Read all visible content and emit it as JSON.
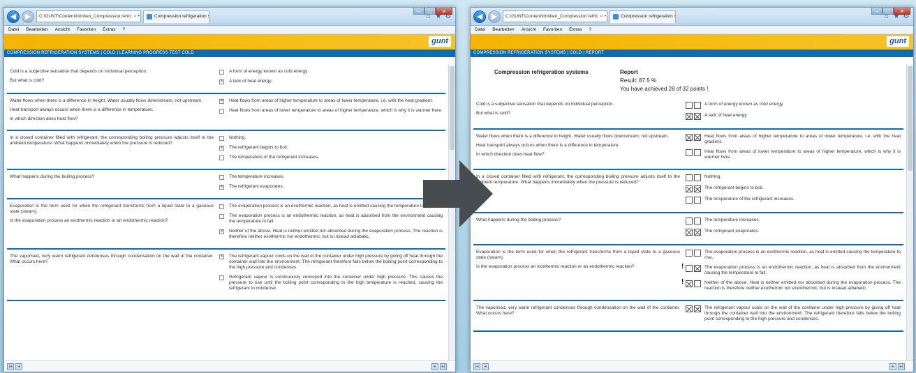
{
  "browser": {
    "address": "C:\\GUNT\\Content\\html\\en_Compression refric",
    "address_icons": "⌕ • C ✕",
    "tab_title": "Compression refrigeration s...",
    "tab_close": "×",
    "menu": [
      "Datei",
      "Bearbeiten",
      "Ansicht",
      "Favoriten",
      "Extras",
      "?"
    ],
    "brand_logo": "gunt",
    "home_icon": "⌂",
    "star_icon": "★",
    "gear_icon": "⚙",
    "window_controls": [
      "–",
      "□",
      "✕"
    ]
  },
  "left": {
    "breadcrumb": "Compression refrigeration systems | Cold | Learning progress test Cold",
    "questions": [
      {
        "text": [
          "Cold is a subjective sensation that depends on individual perception.",
          "But what is cold?"
        ],
        "answers": [
          {
            "text": "A form of energy known as cold energy",
            "checked": false
          },
          {
            "text": "A lack of heat energy",
            "checked": true
          }
        ]
      },
      {
        "text": [
          "Water flows when there is a difference in height. Water usually flows downstream, not upstream.",
          "Heat transport always occurs when there is a difference in temperature.",
          "In which direction does heat flow?"
        ],
        "answers": [
          {
            "text": "Heat flows from areas of higher temperature to areas of lower temperature, i.e. with the heat gradient.",
            "checked": true
          },
          {
            "text": "Heat flows from areas of lower temperature to areas of higher temperature, which is why it is warmer here.",
            "checked": false
          }
        ]
      },
      {
        "text": [
          "In a closed container filled with refrigerant, the corresponding boiling pressure adjusts itself to the ambient temperature. What happens immediately when the pressure is reduced?"
        ],
        "answers": [
          {
            "text": "Nothing.",
            "checked": false
          },
          {
            "text": "The refrigerant begins to boil.",
            "checked": true
          },
          {
            "text": "The temperature of the refrigerant increases.",
            "checked": false
          }
        ]
      },
      {
        "text": [
          "What happens during the boiling process?"
        ],
        "answers": [
          {
            "text": "The temperature increases.",
            "checked": false
          },
          {
            "text": "The refrigerant evaporates.",
            "checked": true
          }
        ]
      },
      {
        "text": [
          "Evaporation is the term used for when the refrigerant transforms from a liquid state to a gaseous state (steam).",
          "Is the evaporation process an exothermic reaction or an endothermic reaction?"
        ],
        "answers": [
          {
            "text": "The evaporation process is an exothermic reaction, as heat is emitted causing the temperature to rise.",
            "checked": false
          },
          {
            "text": "The evaporation process is an endothermic reaction, as heat is absorbed from the environment causing the temperature to fall.",
            "checked": false
          },
          {
            "text": "Neither of the above. Heat is neither emitted nor absorbed during the evaporation process. The reaction is therefore neither exothermic nor endothermic, but is instead adiabatic.",
            "checked": true
          }
        ]
      },
      {
        "text": [
          "The vaporised, very warm refrigerant condenses through condensation on the wall of the container. What occurs here?"
        ],
        "answers": [
          {
            "text": "The refrigerant vapour cools on the wall of the container under high pressure by giving off heat through the container wall into the environment. The refrigerant therefore falls below the boiling point corresponding to the high pressure and condenses.",
            "checked": true
          },
          {
            "text": "Refrigerant vapour is continuously conveyed into the container under high pressure. This causes the pressure to rise until the boiling point corresponding to the high temperature is reached, causing the refrigerant to condense.",
            "checked": false
          }
        ]
      }
    ]
  },
  "right": {
    "breadcrumb": "Compression refrigeration systems | Cold | Report",
    "report_title": "Compression refrigeration systems",
    "report_heading": "Report",
    "result": "Result: 87.5 %",
    "points": "You have achieved 28 of 32 points !",
    "questions": [
      {
        "text": [
          "Cold is a subjective sensation that depends on individual perception.",
          "But what is cold?"
        ],
        "answers": [
          {
            "text": "A form of energy known as cold energy",
            "a": false,
            "b": false,
            "flag": false
          },
          {
            "text": "A lack of heat energy",
            "a": true,
            "b": true,
            "flag": false
          }
        ]
      },
      {
        "text": [
          "Water flows when there is a difference in height. Water usually flows downstream, not upstream.",
          "Heat transport always occurs when there is a difference in temperature.",
          "In which direction does heat flow?"
        ],
        "answers": [
          {
            "text": "Heat flows from areas of higher temperature to areas of lower temperature, i.e. with the heat gradient.",
            "a": true,
            "b": true,
            "flag": false
          },
          {
            "text": "Heat flows from areas of lower temperature to areas of higher temperature, which is why it is warmer here.",
            "a": false,
            "b": false,
            "flag": false
          }
        ]
      },
      {
        "text": [
          "In a closed container filled with refrigerant, the corresponding boiling pressure adjusts itself to the ambient temperature. What happens immediately when the pressure is reduced?"
        ],
        "answers": [
          {
            "text": "Nothing.",
            "a": false,
            "b": false,
            "flag": false
          },
          {
            "text": "The refrigerant begins to boil.",
            "a": true,
            "b": true,
            "flag": false
          },
          {
            "text": "The temperature of the refrigerant increases.",
            "a": false,
            "b": false,
            "flag": false
          }
        ]
      },
      {
        "text": [
          "What happens during the boiling process?"
        ],
        "answers": [
          {
            "text": "The temperature increases.",
            "a": false,
            "b": false,
            "flag": false
          },
          {
            "text": "The refrigerant evaporates.",
            "a": true,
            "b": true,
            "flag": false
          }
        ]
      },
      {
        "text": [
          "Evaporation is the term used for when the refrigerant transforms from a liquid state to a gaseous state (steam).",
          "Is the evaporation process an exothermic reaction or an endothermic reaction?"
        ],
        "answers": [
          {
            "text": "The evaporation process is an exothermic reaction, as heat is emitted causing the temperature to rise.",
            "a": false,
            "b": false,
            "flag": false
          },
          {
            "text": "The evaporation process is an endothermic reaction, as heat is absorbed from the environment causing the temperature to fall.",
            "a": false,
            "b": true,
            "flag": true
          },
          {
            "text": "Neither of the above. Heat is neither emitted nor absorbed during the evaporation process. The reaction is therefore neither exothermic nor endothermic, but is instead adiabatic.",
            "a": true,
            "b": false,
            "flag": true
          }
        ]
      },
      {
        "text": [
          "The vaporised, very warm refrigerant condenses through condensation on the wall of the container. What occurs here?"
        ],
        "answers": [
          {
            "text": "The refrigerant vapour cools on the wall of the container under high pressure by giving off heat through the container wall into the environment. The refrigerant therefore falls below the boiling point corresponding to the high pressure and condenses.",
            "a": true,
            "b": true,
            "flag": false
          }
        ]
      }
    ]
  },
  "pager": {
    "first": "|◂",
    "prev": "◂",
    "next": "▸",
    "last": "▸|"
  },
  "colors": {
    "accent": "#0b6cb6",
    "banner": "#f4b400",
    "arrow": "#474c50"
  }
}
